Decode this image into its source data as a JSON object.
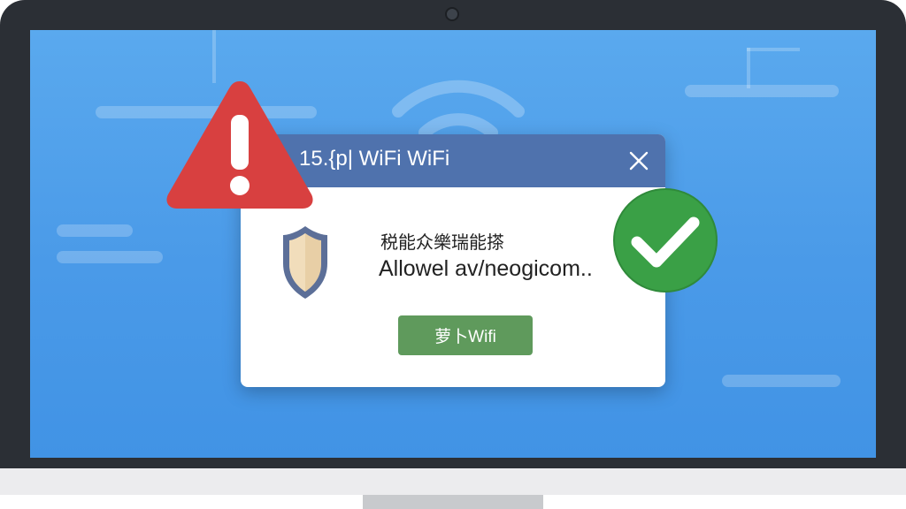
{
  "dialog": {
    "title": "15.{p| WiFi WiFi",
    "heading": "税能众樂瑞能搽",
    "message": "Allowel av/neogicom..",
    "action_label": "萝卜Wifi"
  },
  "icons": {
    "warning": "warning-triangle-icon",
    "shield": "shield-icon",
    "check": "check-circle-icon",
    "wifi": "wifi-icon",
    "close": "close-icon"
  },
  "colors": {
    "screen": "#4a9ae8",
    "titlebar": "#4f72ad",
    "warning": "#d84040",
    "success": "#3aa046",
    "action": "#5f9a5c"
  }
}
